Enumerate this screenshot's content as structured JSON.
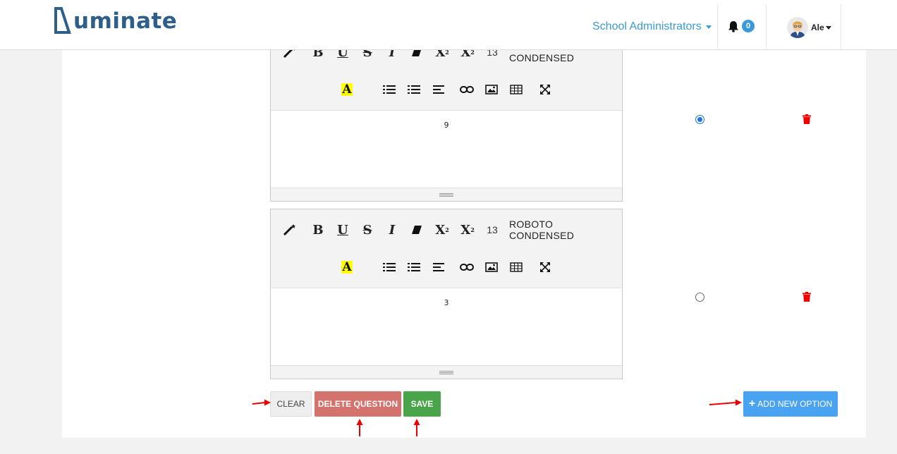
{
  "header": {
    "logo_text": "uminate",
    "role_menu_label": "School Administrators",
    "notifications_count": "0",
    "user_name": "Ale"
  },
  "editors": [
    {
      "font_size": "13",
      "font_name": "ROBOTO CONDENSED",
      "content": "9",
      "is_correct": true
    },
    {
      "font_size": "13",
      "font_name": "ROBOTO CONDENSED",
      "content": "3",
      "is_correct": false
    }
  ],
  "toolbar_icons": [
    "magic-icon",
    "bold-icon",
    "underline-icon",
    "strikethrough-icon",
    "italic-icon",
    "eraser-icon",
    "superscript-icon",
    "subscript-icon",
    "highlight-icon",
    "bullet-list-icon",
    "numbered-list-icon",
    "align-icon",
    "link-icon",
    "image-icon",
    "table-icon",
    "fullscreen-icon"
  ],
  "actions": {
    "clear_label": "CLEAR",
    "delete_label": "DELETE QUESTION",
    "save_label": "SAVE",
    "add_option_label": "ADD NEW OPTION"
  },
  "colors": {
    "brand": "#2e5f8a",
    "accent": "#3a9ad9",
    "delete": "#d4736d",
    "save": "#4aa44a",
    "add": "#4aa3f0",
    "annotation": "#e00000"
  }
}
